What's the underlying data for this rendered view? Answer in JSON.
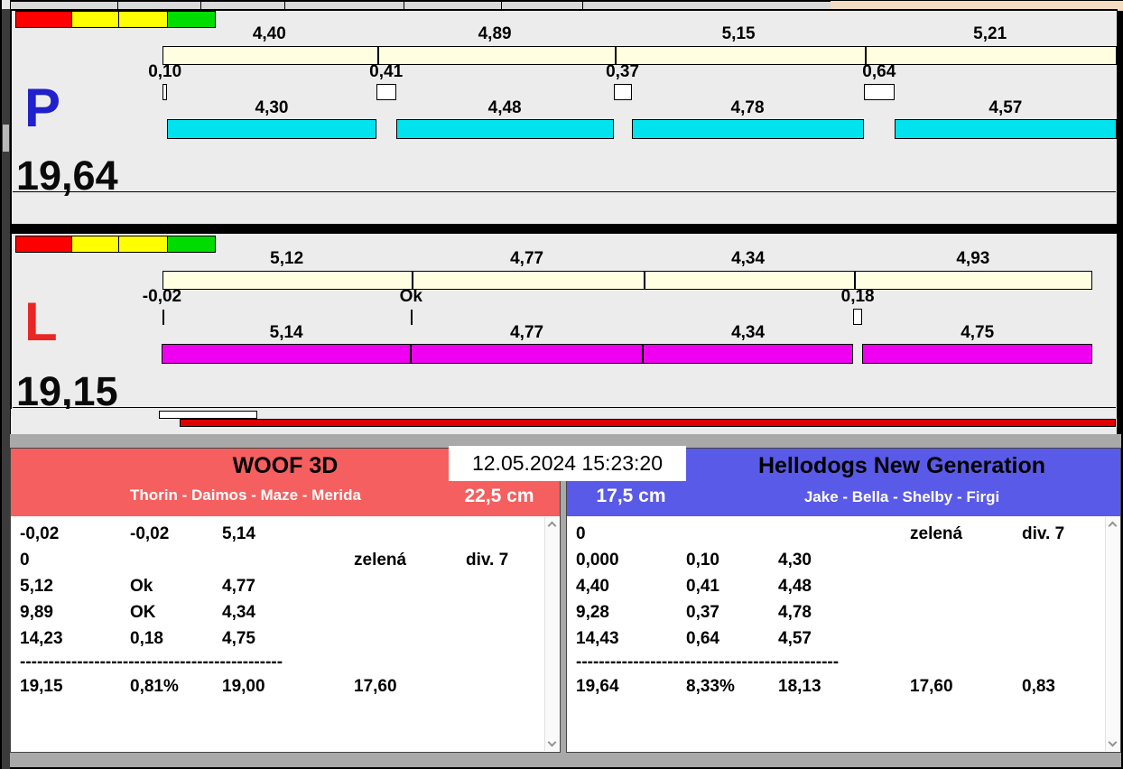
{
  "datetime": "12.05.2024 15:23:20",
  "colors": {
    "panel_bg": "#ececec",
    "split_bar": "#fffee1",
    "traffic_lights": [
      "#ff0000",
      "#ffff00",
      "#ffff00",
      "#00db00"
    ],
    "progress_red": "#de0000",
    "chrome_peach": "#f3dcc1",
    "chrome_grey": "#a9a9a9"
  },
  "lanes": [
    {
      "id": "P",
      "letter": "P",
      "letter_color": "#2020cc",
      "total": "19,64",
      "bar_color": "#00e2ee",
      "split_labels": [
        "4,40",
        "4,89",
        "5,15",
        "5,21"
      ],
      "split_values": [
        4.4,
        4.89,
        5.15,
        5.21
      ],
      "change_labels": [
        "0,10",
        "0,41",
        "0,37",
        "0,64"
      ],
      "change_values": [
        0.1,
        0.41,
        0.37,
        0.64
      ],
      "clean_labels": [
        "4,30",
        "4,48",
        "4,78",
        "4,57"
      ],
      "clean_values": [
        4.3,
        4.48,
        4.78,
        4.57
      ]
    },
    {
      "id": "L",
      "letter": "L",
      "letter_color": "#e92525",
      "total": "19,15",
      "bar_color": "#f000f0",
      "split_labels": [
        "5,12",
        "4,77",
        "4,34",
        "4,93"
      ],
      "split_values": [
        5.12,
        4.77,
        4.34,
        4.93
      ],
      "change_labels": [
        "-0,02",
        "Ok",
        "",
        "0,18"
      ],
      "change_values": [
        -0.02,
        0,
        0,
        0.18
      ],
      "clean_labels": [
        "5,14",
        "4,77",
        "4,34",
        "4,75"
      ],
      "clean_values": [
        5.14,
        4.77,
        4.34,
        4.75
      ]
    }
  ],
  "teams": {
    "left": {
      "name": "WOOF 3D",
      "dogs": "Thorin - Daimos - Maze - Merida",
      "height": "22,5 cm",
      "bg": "#f55f5f",
      "rows": [
        [
          "-0,02",
          "-0,02",
          "5,14",
          "",
          ""
        ],
        [
          "0",
          "",
          "",
          "zelená",
          "div. 7"
        ],
        [
          "5,12",
          "Ok",
          "4,77",
          "",
          ""
        ],
        [
          "9,89",
          "OK",
          "4,34",
          "",
          ""
        ],
        [
          "14,23",
          "0,18",
          "4,75",
          "",
          ""
        ]
      ],
      "separator": "----------------------------------------------",
      "summary": [
        "19,15",
        "0,81%",
        "19,00",
        "17,60",
        ""
      ]
    },
    "right": {
      "name": "Hellodogs New Generation",
      "dogs": "Jake - Bella - Shelby - Firgi",
      "height": "17,5 cm",
      "bg": "#5a5ae8",
      "rows": [
        [
          "0",
          "",
          "",
          "zelená",
          "div. 7"
        ],
        [
          "0,000",
          "0,10",
          "4,30",
          "",
          ""
        ],
        [
          "4,40",
          "0,41",
          "4,48",
          "",
          ""
        ],
        [
          "9,28",
          "0,37",
          "4,78",
          "",
          ""
        ],
        [
          "14,43",
          "0,64",
          "4,57",
          "",
          ""
        ]
      ],
      "separator": "----------------------------------------------",
      "summary": [
        "19,64",
        "8,33%",
        "18,13",
        "17,60",
        "0,83"
      ]
    }
  }
}
